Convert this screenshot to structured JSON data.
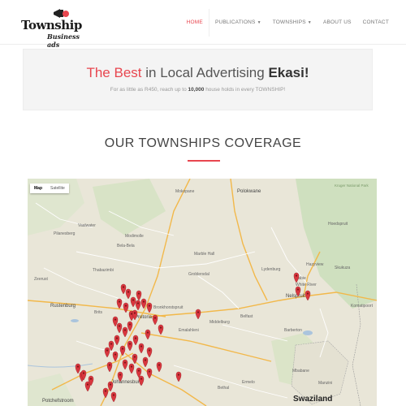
{
  "brand": {
    "name": "Township",
    "tagline": "Business ads"
  },
  "nav": {
    "items": [
      {
        "label": "HOME",
        "active": true,
        "dropdown": false
      },
      {
        "label": "PUBLICATIONS",
        "active": false,
        "dropdown": true
      },
      {
        "label": "TOWNSHIPS",
        "active": false,
        "dropdown": true
      },
      {
        "label": "ABOUT US",
        "active": false,
        "dropdown": false
      },
      {
        "label": "CONTACT",
        "active": false,
        "dropdown": false
      }
    ]
  },
  "banner": {
    "headline_highlight": "The Best",
    "headline_middle": " in Local Advertising ",
    "headline_bold": "Ekasi!",
    "sub_before": "For as little as R450, reach up to ",
    "sub_bold": "10,000",
    "sub_after": " house holds in every TOWNSHIP!"
  },
  "section": {
    "title": "OUR TOWNSHIPS COVERAGE"
  },
  "map": {
    "type_buttons": [
      "Map",
      "Satellite"
    ],
    "selected_type": "Map",
    "places": [
      {
        "name": "Mokopane"
      },
      {
        "name": "Polokwane"
      },
      {
        "name": "Hoedspruit"
      },
      {
        "name": "Kruger National Park"
      },
      {
        "name": "Bela-Bela"
      },
      {
        "name": "Modimolle"
      },
      {
        "name": "Marble Hall"
      },
      {
        "name": "Groblersdal"
      },
      {
        "name": "Lydenburg"
      },
      {
        "name": "Sabie"
      },
      {
        "name": "Hazyview"
      },
      {
        "name": "Skukuza"
      },
      {
        "name": "Pilanesberg"
      },
      {
        "name": "Rustenburg"
      },
      {
        "name": "Brits"
      },
      {
        "name": "Pretoria"
      },
      {
        "name": "Bronkhorstspruit"
      },
      {
        "name": "Emalahleni"
      },
      {
        "name": "Middelburg"
      },
      {
        "name": "Belfast"
      },
      {
        "name": "White River"
      },
      {
        "name": "Nelspruit"
      },
      {
        "name": "Komatipoort"
      },
      {
        "name": "Barberton"
      },
      {
        "name": "Johannesburg"
      },
      {
        "name": "Bethal"
      },
      {
        "name": "Ermelo"
      },
      {
        "name": "Potchefstroom"
      },
      {
        "name": "Mbabane"
      },
      {
        "name": "Manzini"
      },
      {
        "name": "Swaziland"
      },
      {
        "name": "Zeerust"
      },
      {
        "name": "Thabazimbi"
      },
      {
        "name": "Vaalwater"
      }
    ]
  },
  "colors": {
    "accent": "#e8464f",
    "banner_bg": "#f4f4f4",
    "map_land": "#e9e6d8",
    "marker": "#d9363e"
  },
  "icons": {
    "logo": "megaphone-icon",
    "marker": "map-marker-icon",
    "caret": "caret-down-icon"
  }
}
